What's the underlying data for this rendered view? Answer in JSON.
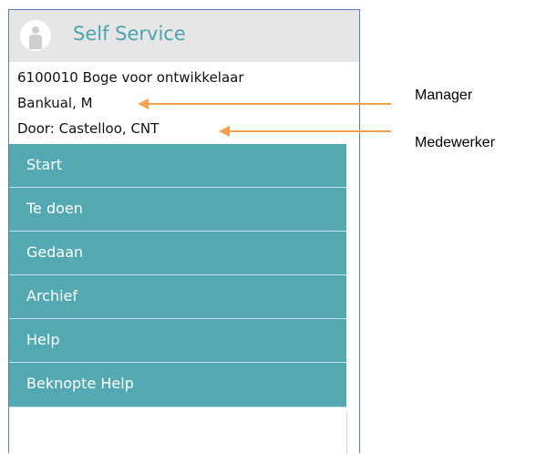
{
  "header": {
    "title": "Self Service",
    "icon": "user-avatar-icon"
  },
  "info": {
    "department": "6100010 Boge voor ontwikkelaar",
    "manager_name": "Bankual, M",
    "employee_line": "Door: Castelloo, CNT"
  },
  "menu": {
    "items": [
      {
        "label": "Start"
      },
      {
        "label": "Te doen"
      },
      {
        "label": "Gedaan"
      },
      {
        "label": "Archief"
      },
      {
        "label": "Help"
      },
      {
        "label": "Beknopte Help"
      }
    ]
  },
  "annotations": {
    "manager": "Manager",
    "employee": "Medewerker"
  },
  "colors": {
    "accent": "#54a8b1",
    "title": "#4ba3ad",
    "header_bg": "#e6e6e6",
    "arrow": "#f5a04a",
    "border": "#5b7fb8"
  }
}
